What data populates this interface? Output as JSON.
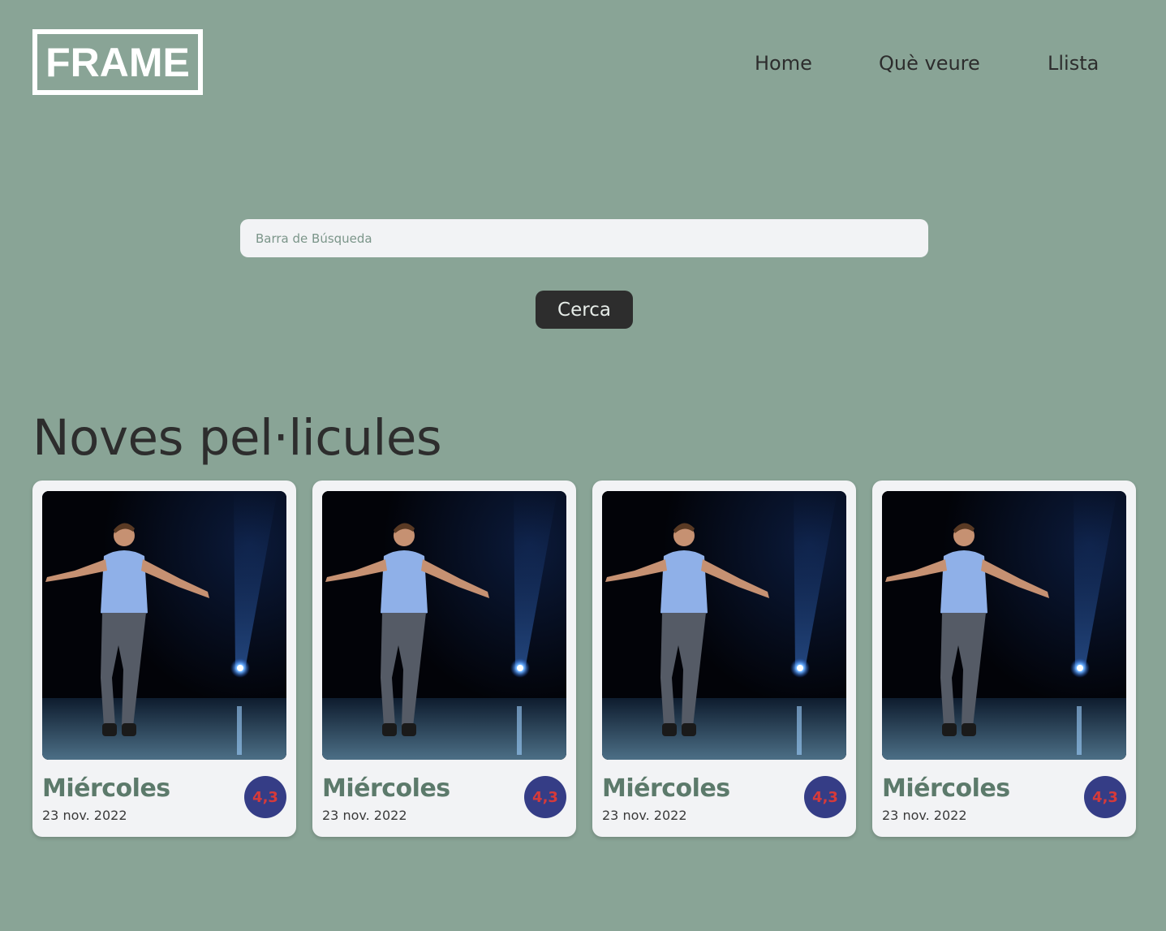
{
  "header": {
    "logo_text": "FRAME",
    "nav": [
      {
        "label": "Home"
      },
      {
        "label": "Què veure"
      },
      {
        "label": "Llista"
      }
    ]
  },
  "search": {
    "placeholder": "Barra de Búsqueda",
    "value": "",
    "button_label": "Cerca"
  },
  "section": {
    "title": "Noves pel·licules"
  },
  "movies": [
    {
      "title": "Miércoles",
      "date": "23 nov. 2022",
      "rating": "4,3",
      "poster_alt": "dancer-on-stage"
    },
    {
      "title": "Miércoles",
      "date": "23 nov. 2022",
      "rating": "4,3",
      "poster_alt": "dancer-on-stage"
    },
    {
      "title": "Miércoles",
      "date": "23 nov. 2022",
      "rating": "4,3",
      "poster_alt": "dancer-on-stage"
    },
    {
      "title": "Miércoles",
      "date": "23 nov. 2022",
      "rating": "4,3",
      "poster_alt": "dancer-on-stage"
    }
  ],
  "colors": {
    "background": "#89a496",
    "card": "#f2f3f5",
    "button": "#2d2d2d",
    "rating_badge": "#353d86",
    "rating_text": "#d63a3a",
    "card_title": "#5c7a6b"
  }
}
